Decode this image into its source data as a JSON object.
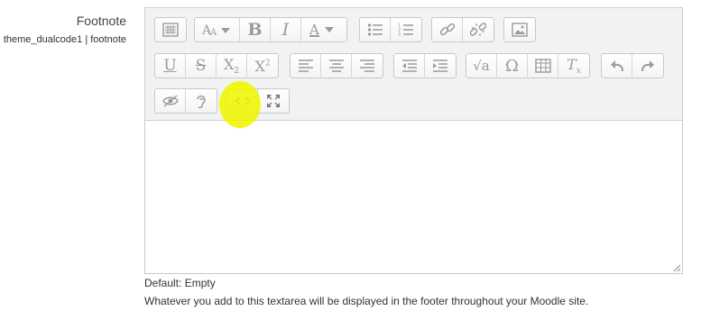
{
  "field": {
    "title": "Footnote",
    "setting_name": "theme_dualcode1 | footnote"
  },
  "editor": {
    "textarea_value": "",
    "highlight_color": "#f0f500"
  },
  "toolbar": {
    "rows": [
      [
        {
          "group": "collapse",
          "buttons": [
            {
              "icon": "toolbar-toggle-icon",
              "glyph": ""
            }
          ]
        },
        {
          "group": "style",
          "buttons": [
            {
              "icon": "font-size-icon",
              "glyph": "AA▾"
            },
            {
              "icon": "bold-icon",
              "glyph": "B"
            },
            {
              "icon": "italic-icon",
              "glyph": "I"
            },
            {
              "icon": "font-color-icon",
              "glyph": "A▾"
            }
          ]
        },
        {
          "group": "list",
          "buttons": [
            {
              "icon": "bulleted-list-icon",
              "glyph": ""
            },
            {
              "icon": "numbered-list-icon",
              "glyph": ""
            }
          ]
        },
        {
          "group": "links",
          "buttons": [
            {
              "icon": "link-icon",
              "glyph": ""
            },
            {
              "icon": "unlink-icon",
              "glyph": ""
            }
          ]
        },
        {
          "group": "files",
          "buttons": [
            {
              "icon": "image-icon",
              "glyph": ""
            }
          ]
        }
      ],
      [
        {
          "group": "style2",
          "buttons": [
            {
              "icon": "underline-icon",
              "glyph": "U"
            },
            {
              "icon": "strikethrough-icon",
              "glyph": "S"
            },
            {
              "icon": "subscript-icon",
              "glyph": "X₂"
            },
            {
              "icon": "superscript-icon",
              "glyph": "X²"
            }
          ]
        },
        {
          "group": "align",
          "buttons": [
            {
              "icon": "align-left-icon",
              "glyph": ""
            },
            {
              "icon": "align-center-icon",
              "glyph": ""
            },
            {
              "icon": "align-right-icon",
              "glyph": ""
            }
          ]
        },
        {
          "group": "indent",
          "buttons": [
            {
              "icon": "outdent-icon",
              "glyph": ""
            },
            {
              "icon": "indent-icon",
              "glyph": ""
            }
          ]
        },
        {
          "group": "insert",
          "buttons": [
            {
              "icon": "equation-icon",
              "glyph": "√a"
            },
            {
              "icon": "special-character-icon",
              "glyph": "Ω"
            },
            {
              "icon": "table-icon",
              "glyph": ""
            },
            {
              "icon": "clear-formatting-icon",
              "glyph": "Tx"
            }
          ]
        },
        {
          "group": "undo",
          "buttons": [
            {
              "icon": "undo-icon",
              "glyph": ""
            },
            {
              "icon": "redo-icon",
              "glyph": ""
            }
          ]
        }
      ],
      [
        {
          "group": "accessibility",
          "buttons": [
            {
              "icon": "accessibility-checker-icon",
              "glyph": ""
            },
            {
              "icon": "screen-reader-helper-icon",
              "glyph": ""
            }
          ]
        },
        {
          "group": "other",
          "buttons": [
            {
              "icon": "html-source-icon",
              "glyph": "<>"
            },
            {
              "icon": "fullscreen-icon",
              "glyph": ""
            }
          ]
        }
      ]
    ]
  },
  "default_info": "Default: Empty",
  "description": "Whatever you add to this textarea will be displayed in the footer throughout your Moodle site."
}
